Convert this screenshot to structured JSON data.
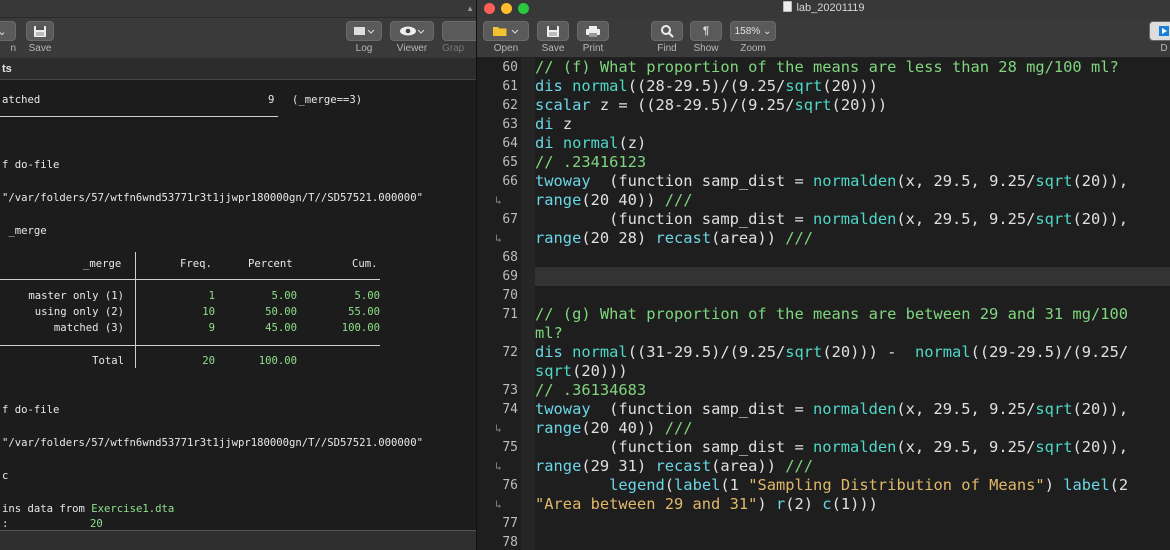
{
  "left": {
    "toolbar": {
      "partial_open": "n",
      "save": "Save",
      "log": "Log",
      "viewer": "Viewer",
      "graph_partial": "Grap"
    },
    "panel_header": "ts",
    "results": {
      "matched_label": "atched",
      "matched_count": "9",
      "matched_cond": "(_merge==3)",
      "end_do_file_1": "f do-file",
      "path_1": "\"/var/folders/57/wtfn6wnd53771r3t1jjwpr180000gn/T//SD57521.000000\"",
      "tab_cmd": " _merge",
      "table": {
        "headers": {
          "var": "_merge",
          "freq": "Freq.",
          "percent": "Percent",
          "cum": "Cum."
        },
        "rows": [
          {
            "label": "master only (1)",
            "freq": "1",
            "percent": "5.00",
            "cum": "5.00"
          },
          {
            "label": "using only (2)",
            "freq": "10",
            "percent": "50.00",
            "cum": "55.00"
          },
          {
            "label": "matched (3)",
            "freq": "9",
            "percent": "45.00",
            "cum": "100.00"
          }
        ],
        "total": {
          "label": "Total",
          "freq": "20",
          "percent": "100.00"
        }
      },
      "end_do_file_2": "f do-file",
      "path_2": "\"/var/folders/57/wtfn6wnd53771r3t1jjwpr180000gn/T//SD57521.000000\"",
      "desc_cmd": "c",
      "contains_prefix": "ins data from ",
      "contains_file": "Exercise1.dta",
      "obs_label": ":",
      "obs_value": "20"
    }
  },
  "right": {
    "window_title": "lab_20201119",
    "toolbar": {
      "open": "Open",
      "save": "Save",
      "print": "Print",
      "find": "Find",
      "show": "Show",
      "zoom": "Zoom",
      "zoom_value": "158%",
      "partial": "D"
    },
    "colors": {
      "comment": "#7fd67f",
      "keyword": "#6bd6e6",
      "string": "#e0b86a"
    },
    "lines": [
      {
        "n": "60",
        "wrap": false,
        "segs": [
          [
            "c-com",
            "// (f) What proportion of the means are less than 28 mg/100 ml?"
          ]
        ]
      },
      {
        "n": "61",
        "wrap": false,
        "segs": [
          [
            "c-kw",
            "dis"
          ],
          [
            "c-txt",
            " "
          ],
          [
            "c-fn",
            "normal"
          ],
          [
            "c-txt",
            "((28-29.5)/(9.25/"
          ],
          [
            "c-fn",
            "sqrt"
          ],
          [
            "c-txt",
            "(20)))"
          ]
        ]
      },
      {
        "n": "62",
        "wrap": false,
        "segs": [
          [
            "c-kw",
            "scalar"
          ],
          [
            "c-txt",
            " z = ((28-29.5)/(9.25/"
          ],
          [
            "c-fn",
            "sqrt"
          ],
          [
            "c-txt",
            "(20)))"
          ]
        ]
      },
      {
        "n": "63",
        "wrap": false,
        "segs": [
          [
            "c-kw",
            "di"
          ],
          [
            "c-txt",
            " z"
          ]
        ]
      },
      {
        "n": "64",
        "wrap": false,
        "segs": [
          [
            "c-kw",
            "di"
          ],
          [
            "c-txt",
            " "
          ],
          [
            "c-fn",
            "normal"
          ],
          [
            "c-txt",
            "(z)"
          ]
        ]
      },
      {
        "n": "65",
        "wrap": false,
        "segs": [
          [
            "c-com",
            "// .23416123"
          ]
        ]
      },
      {
        "n": "66",
        "wrap": false,
        "segs": [
          [
            "c-kw",
            "twoway"
          ],
          [
            "c-txt",
            "  (function samp_dist = "
          ],
          [
            "c-fn",
            "normalden"
          ],
          [
            "c-txt",
            "(x, 29.5, 9.25/"
          ],
          [
            "c-fn",
            "sqrt"
          ],
          [
            "c-txt",
            "(20)),"
          ]
        ]
      },
      {
        "n": "",
        "wrap": true,
        "segs": [
          [
            "c-kw",
            "range"
          ],
          [
            "c-txt",
            "(20 40)) "
          ],
          [
            "c-com",
            "///"
          ]
        ]
      },
      {
        "n": "67",
        "wrap": false,
        "segs": [
          [
            "c-txt",
            "        (function samp_dist = "
          ],
          [
            "c-fn",
            "normalden"
          ],
          [
            "c-txt",
            "(x, 29.5, 9.25/"
          ],
          [
            "c-fn",
            "sqrt"
          ],
          [
            "c-txt",
            "(20)),"
          ]
        ]
      },
      {
        "n": "",
        "wrap": true,
        "segs": [
          [
            "c-kw",
            "range"
          ],
          [
            "c-txt",
            "(20 28) "
          ],
          [
            "c-kw",
            "recast"
          ],
          [
            "c-txt",
            "(area)) "
          ],
          [
            "c-com",
            "///"
          ]
        ]
      },
      {
        "n": "68",
        "wrap": false,
        "segs": []
      },
      {
        "n": "69",
        "wrap": false,
        "segs": [],
        "highlight": true
      },
      {
        "n": "70",
        "wrap": false,
        "segs": []
      },
      {
        "n": "71",
        "wrap": false,
        "segs": [
          [
            "c-com",
            "// (g) What proportion of the means are between 29 and 31 mg/100"
          ]
        ]
      },
      {
        "n": "",
        "wrap": false,
        "segs": [
          [
            "c-com",
            "ml?"
          ]
        ]
      },
      {
        "n": "72",
        "wrap": false,
        "segs": [
          [
            "c-kw",
            "dis"
          ],
          [
            "c-txt",
            " "
          ],
          [
            "c-fn",
            "normal"
          ],
          [
            "c-txt",
            "((31-29.5)/(9.25/"
          ],
          [
            "c-fn",
            "sqrt"
          ],
          [
            "c-txt",
            "(20))) -  "
          ],
          [
            "c-fn",
            "normal"
          ],
          [
            "c-txt",
            "((29-29.5)/(9.25/"
          ]
        ]
      },
      {
        "n": "",
        "wrap": false,
        "segs": [
          [
            "c-fn",
            "sqrt"
          ],
          [
            "c-txt",
            "(20)))"
          ]
        ]
      },
      {
        "n": "73",
        "wrap": false,
        "segs": [
          [
            "c-com",
            "// .36134683"
          ]
        ]
      },
      {
        "n": "74",
        "wrap": false,
        "segs": [
          [
            "c-kw",
            "twoway"
          ],
          [
            "c-txt",
            "  (function samp_dist = "
          ],
          [
            "c-fn",
            "normalden"
          ],
          [
            "c-txt",
            "(x, 29.5, 9.25/"
          ],
          [
            "c-fn",
            "sqrt"
          ],
          [
            "c-txt",
            "(20)),"
          ]
        ]
      },
      {
        "n": "",
        "wrap": true,
        "segs": [
          [
            "c-kw",
            "range"
          ],
          [
            "c-txt",
            "(20 40)) "
          ],
          [
            "c-com",
            "///"
          ]
        ]
      },
      {
        "n": "75",
        "wrap": false,
        "segs": [
          [
            "c-txt",
            "        (function samp_dist = "
          ],
          [
            "c-fn",
            "normalden"
          ],
          [
            "c-txt",
            "(x, 29.5, 9.25/"
          ],
          [
            "c-fn",
            "sqrt"
          ],
          [
            "c-txt",
            "(20)),"
          ]
        ]
      },
      {
        "n": "",
        "wrap": true,
        "segs": [
          [
            "c-kw",
            "range"
          ],
          [
            "c-txt",
            "(29 31) "
          ],
          [
            "c-kw",
            "recast"
          ],
          [
            "c-txt",
            "(area)) "
          ],
          [
            "c-com",
            "///"
          ]
        ]
      },
      {
        "n": "76",
        "wrap": false,
        "segs": [
          [
            "c-txt",
            "        "
          ],
          [
            "c-kw",
            "legend"
          ],
          [
            "c-txt",
            "("
          ],
          [
            "c-kw",
            "label"
          ],
          [
            "c-txt",
            "(1 "
          ],
          [
            "c-str",
            "\"Sampling Distribution of Means\""
          ],
          [
            "c-txt",
            ") "
          ],
          [
            "c-kw",
            "label"
          ],
          [
            "c-txt",
            "(2"
          ]
        ]
      },
      {
        "n": "",
        "wrap": true,
        "segs": [
          [
            "c-str",
            "\"Area between 29 and 31\""
          ],
          [
            "c-txt",
            ") "
          ],
          [
            "c-kw",
            "r"
          ],
          [
            "c-txt",
            "(2) "
          ],
          [
            "c-kw",
            "c"
          ],
          [
            "c-txt",
            "(1)))"
          ]
        ]
      },
      {
        "n": "77",
        "wrap": false,
        "segs": []
      },
      {
        "n": "78",
        "wrap": false,
        "segs": []
      }
    ]
  }
}
